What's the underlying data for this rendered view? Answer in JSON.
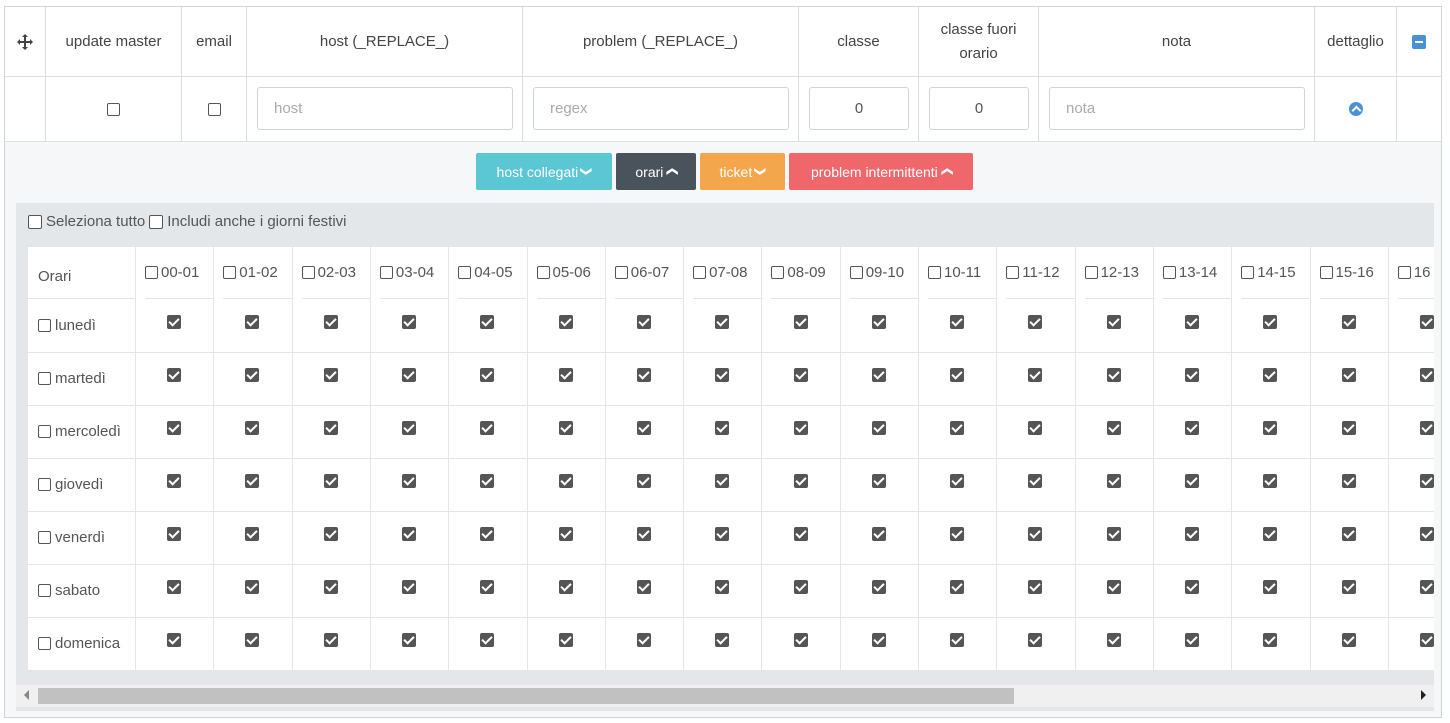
{
  "header": {
    "move_icon": "move-icon",
    "cols": [
      "update master",
      "email",
      "host (_REPLACE_)",
      "problem (_REPLACE_)",
      "classe",
      "classe fuori orario",
      "nota",
      "dettaglio"
    ],
    "host_placeholder": "host",
    "problem_placeholder": "regex",
    "classe_value": "0",
    "classe_fuori_value": "0",
    "nota_placeholder": "nota"
  },
  "buttons": {
    "host_collegati": "host collegati",
    "orari": "orari",
    "ticket": "ticket",
    "problem_intermittenti": "problem intermittenti"
  },
  "colors": {
    "host_collegati": "#5bc6d4",
    "orari": "#4a535c",
    "ticket": "#f3a64b",
    "problem_intermittenti": "#f0676b",
    "accent": "#4a90d9"
  },
  "selection": {
    "select_all": "Seleziona tutto",
    "include_holidays": "Includi anche i giorni festivi"
  },
  "schedule": {
    "corner": "Orari",
    "hours": [
      "00-01",
      "01-02",
      "02-03",
      "03-04",
      "04-05",
      "05-06",
      "06-07",
      "07-08",
      "08-09",
      "09-10",
      "10-11",
      "11-12",
      "12-13",
      "13-14",
      "14-15",
      "15-16",
      "16"
    ],
    "days": [
      "lunedì",
      "martedì",
      "mercoledì",
      "giovedì",
      "venerdì",
      "sabato",
      "domenica"
    ]
  }
}
